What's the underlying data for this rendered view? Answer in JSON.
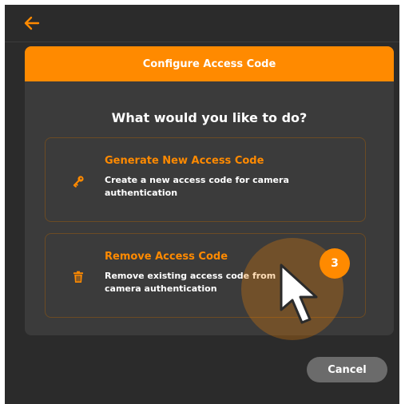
{
  "header": {
    "back_icon": "arrow-left-icon"
  },
  "dialog": {
    "title": "Configure Access Code",
    "question": "What would you like to do?",
    "options": [
      {
        "title": "Generate New Access Code",
        "description": "Create a new access code for camera authentication",
        "icon": "key-icon"
      },
      {
        "title": "Remove Access Code",
        "description": "Remove existing access code from camera authentication",
        "icon": "trash-icon"
      }
    ]
  },
  "footer": {
    "cancel_label": "Cancel"
  },
  "overlay": {
    "step_number": "3"
  },
  "colors": {
    "accent": "#ff8a00",
    "background": "#2b2b2b",
    "dialog": "#3b3b3b",
    "button": "#6b6b6b"
  }
}
